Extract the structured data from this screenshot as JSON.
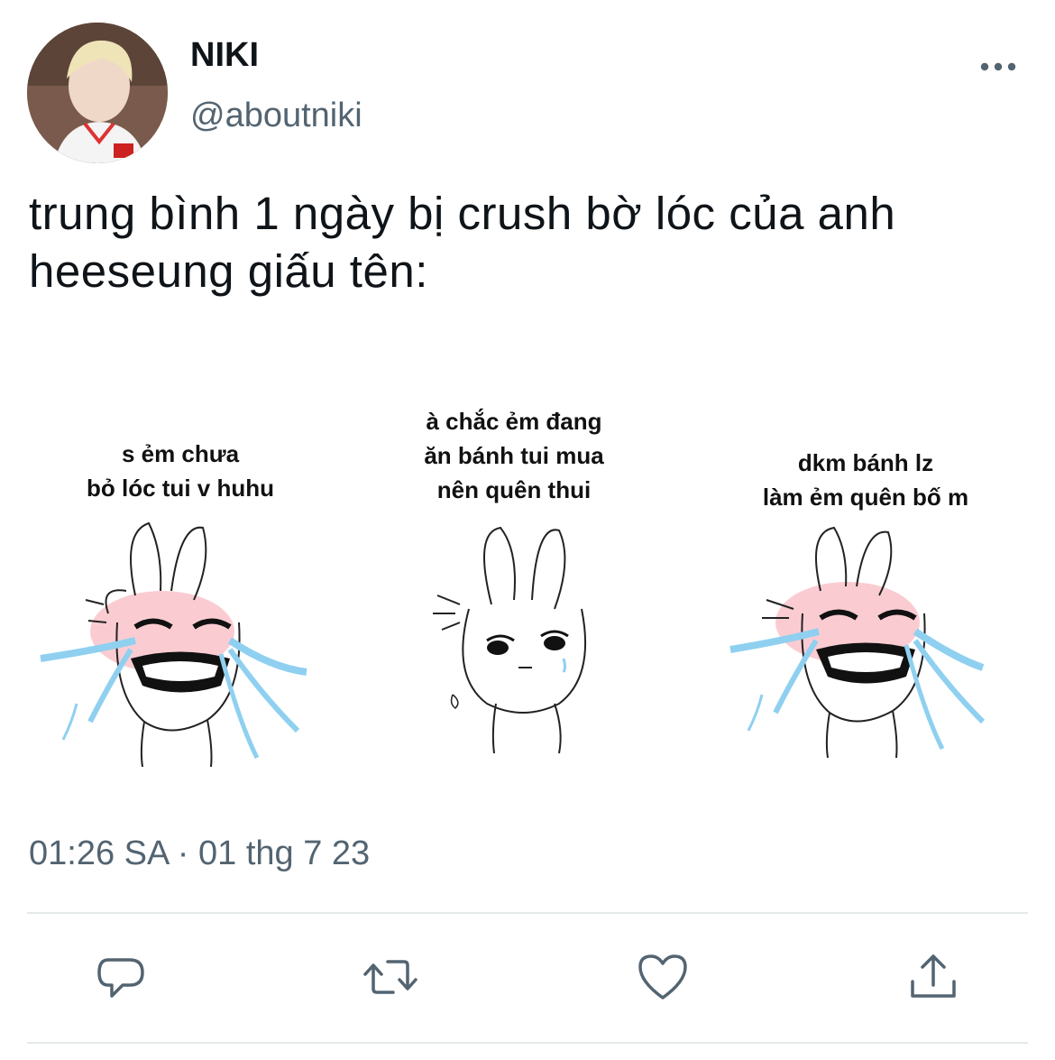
{
  "tweet": {
    "author_name": "NIKI",
    "author_handle": "@aboutniki",
    "text": "trung bình 1 ngày bị crush bờ lóc của anh heeseung giấu tên:",
    "timestamp": "01:26 SA · 01 thg 7 23"
  },
  "media": {
    "panels": [
      {
        "caption": "s ẻm chưa\nbỏ lóc tui v huhu",
        "mood": "crying"
      },
      {
        "caption": "à chắc ẻm đang\năn bánh tui mua\nnên quên thui",
        "mood": "thinking"
      },
      {
        "caption": "dkm bánh lz\nlàm ẻm quên bố m",
        "mood": "crying"
      }
    ]
  },
  "icons": {
    "more": "more-horizontal-icon",
    "reply": "reply-icon",
    "retweet": "retweet-icon",
    "like": "heart-icon",
    "share": "share-icon"
  },
  "colors": {
    "secondary_text": "#536471",
    "icon": "#536471",
    "tears": "#8fd0f0",
    "blush": "#f5a3ad"
  }
}
